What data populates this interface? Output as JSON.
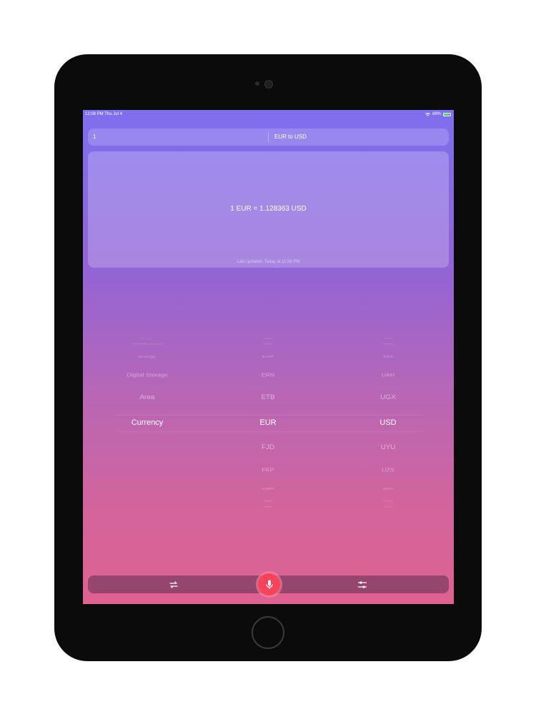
{
  "status_bar": {
    "time": "12:08 PM",
    "date": "Thu Jul 4",
    "battery": "89%"
  },
  "converter": {
    "amount_value": "1",
    "pair_label": "EUR to USD"
  },
  "result": {
    "conversion": "1 EUR = 1.128363 USD",
    "last_updated": "Last updated: Today at 11:08 PM"
  },
  "picker": {
    "categories": [
      "Length",
      "Time/Economy",
      "Energy",
      "Digital Storage",
      "Area",
      "Currency"
    ],
    "from_units": [
      "CUP",
      "GGP",
      "DZD",
      "EGP",
      "ERN",
      "ETB",
      "EUR",
      "FJD",
      "FKP",
      "GBP",
      "GEL",
      "GGP",
      "GHS"
    ],
    "to_units": [
      "TTD",
      "TVD",
      "TWD",
      "TZS",
      "UAH",
      "UGX",
      "USD",
      "UYU",
      "UZS",
      "VEF",
      "VND",
      "VUV",
      "WST"
    ]
  },
  "toolbar": {
    "swap_icon": "swap-arrows-icon",
    "mic_icon": "microphone-icon",
    "settings_icon": "sliders-icon"
  },
  "colors": {
    "gradient_top": "#7e6fef",
    "gradient_bottom": "#df6290",
    "mic_red": "#f7445b"
  }
}
